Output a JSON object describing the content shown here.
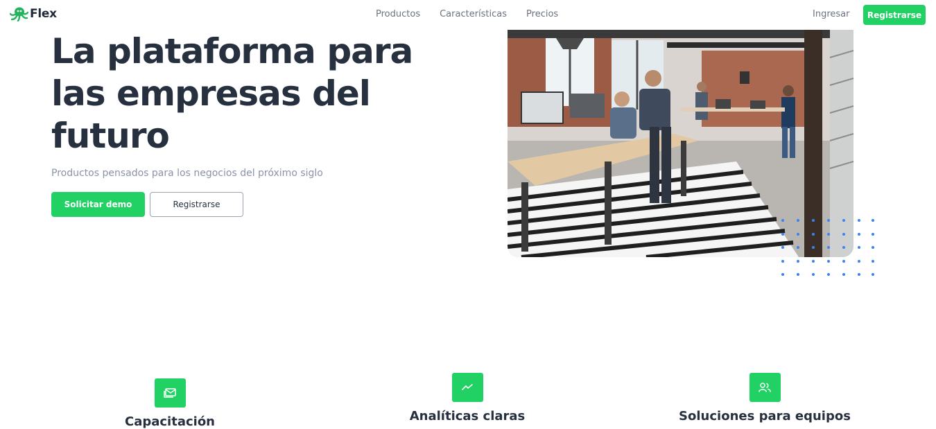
{
  "nav": {
    "brand": "Flex",
    "links": [
      "Productos",
      "Características",
      "Precios"
    ],
    "login": "Ingresar",
    "register": "Registrarse"
  },
  "hero": {
    "title": "La plataforma para las empresas del futuro",
    "subtitle": "Productos pensados para los negocios del próximo siglo",
    "primary_cta": "Solicitar demo",
    "secondary_cta": "Registrarse",
    "image_icon": "office-photo"
  },
  "features": [
    {
      "title": "Capacitación",
      "icon": "mail-stack-icon"
    },
    {
      "title": "Analíticas claras",
      "icon": "trend-icon"
    },
    {
      "title": "Soluciones para equipos",
      "icon": "users-icon"
    }
  ],
  "colors": {
    "accent": "#22d163",
    "text_dark": "#27303f",
    "text_muted": "#8a92a6",
    "dots": "#3b82f6"
  }
}
